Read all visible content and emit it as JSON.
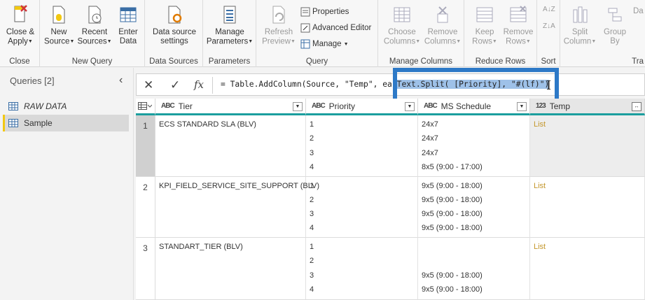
{
  "ribbon": {
    "groups": {
      "close": {
        "label": "Close",
        "btn": [
          "Close &",
          "Apply"
        ]
      },
      "new_query": {
        "label": "New Query",
        "new_source": [
          "New",
          "Source"
        ],
        "recent": [
          "Recent",
          "Sources"
        ],
        "enter": [
          "Enter",
          "Data"
        ]
      },
      "data_sources": {
        "label": "Data Sources",
        "btn": [
          "Data source",
          "settings"
        ]
      },
      "parameters": {
        "label": "Parameters",
        "btn": [
          "Manage",
          "Parameters"
        ]
      },
      "query": {
        "label": "Query",
        "refresh": [
          "Refresh",
          "Preview"
        ],
        "properties": "Properties",
        "advanced_editor": "Advanced Editor",
        "manage": "Manage"
      },
      "manage_columns": {
        "label": "Manage Columns",
        "choose": [
          "Choose",
          "Columns"
        ],
        "remove": [
          "Remove",
          "Columns"
        ]
      },
      "reduce_rows": {
        "label": "Reduce Rows",
        "keep": [
          "Keep",
          "Rows"
        ],
        "remove": [
          "Remove",
          "Rows"
        ]
      },
      "sort": {
        "label": "Sort"
      },
      "transform": {
        "label": "Tra",
        "split": [
          "Split",
          "Column"
        ],
        "group": [
          "Group",
          "By"
        ],
        "partial": "Da"
      }
    }
  },
  "queries": {
    "header": "Queries [2]",
    "items": [
      {
        "name": "RAW DATA",
        "italic": true
      },
      {
        "name": "Sample",
        "selected": true
      }
    ]
  },
  "formula": {
    "prefix": "= Table.AddColumn(Source, \"Temp\", eac",
    "highlight": "Text.Split( [Priority], \"#(lf)\")",
    "suffix": ""
  },
  "grid": {
    "columns": [
      {
        "type": "ABC",
        "name": "Tier"
      },
      {
        "type": "ABC",
        "name": "Priority"
      },
      {
        "type": "ABC",
        "name": "MS Schedule"
      },
      {
        "type": "123",
        "name": "Temp"
      }
    ],
    "rows": [
      {
        "num": "1",
        "tier": "ECS STANDARD SLA (BLV)",
        "priority": [
          "1",
          "2",
          "3",
          "4"
        ],
        "schedule": [
          "24x7",
          "24x7",
          "24x7",
          "8x5 (9:00 - 17:00)"
        ],
        "temp": "List"
      },
      {
        "num": "2",
        "tier": "KPI_FIELD_SERVICE_SITE_SUPPORT (BLV)",
        "priority": [
          "1",
          "2",
          "3",
          "4"
        ],
        "schedule": [
          "9x5 (9:00 - 18:00)",
          "9x5 (9:00 - 18:00)",
          "9x5 (9:00 - 18:00)",
          "9x5 (9:00 - 18:00)"
        ],
        "temp": "List"
      },
      {
        "num": "3",
        "tier": "STANDART_TIER (BLV)",
        "priority": [
          "1",
          "2",
          "3",
          "4"
        ],
        "schedule": [
          "",
          "",
          "9x5 (9:00 - 18:00)",
          "9x5 (9:00 - 18:00)"
        ],
        "temp": "List"
      }
    ]
  },
  "colors": {
    "accent": "#f2c811",
    "teal": "#1b9e9e",
    "highlight_box": "#2d79c7",
    "list_text": "#c4962a"
  }
}
